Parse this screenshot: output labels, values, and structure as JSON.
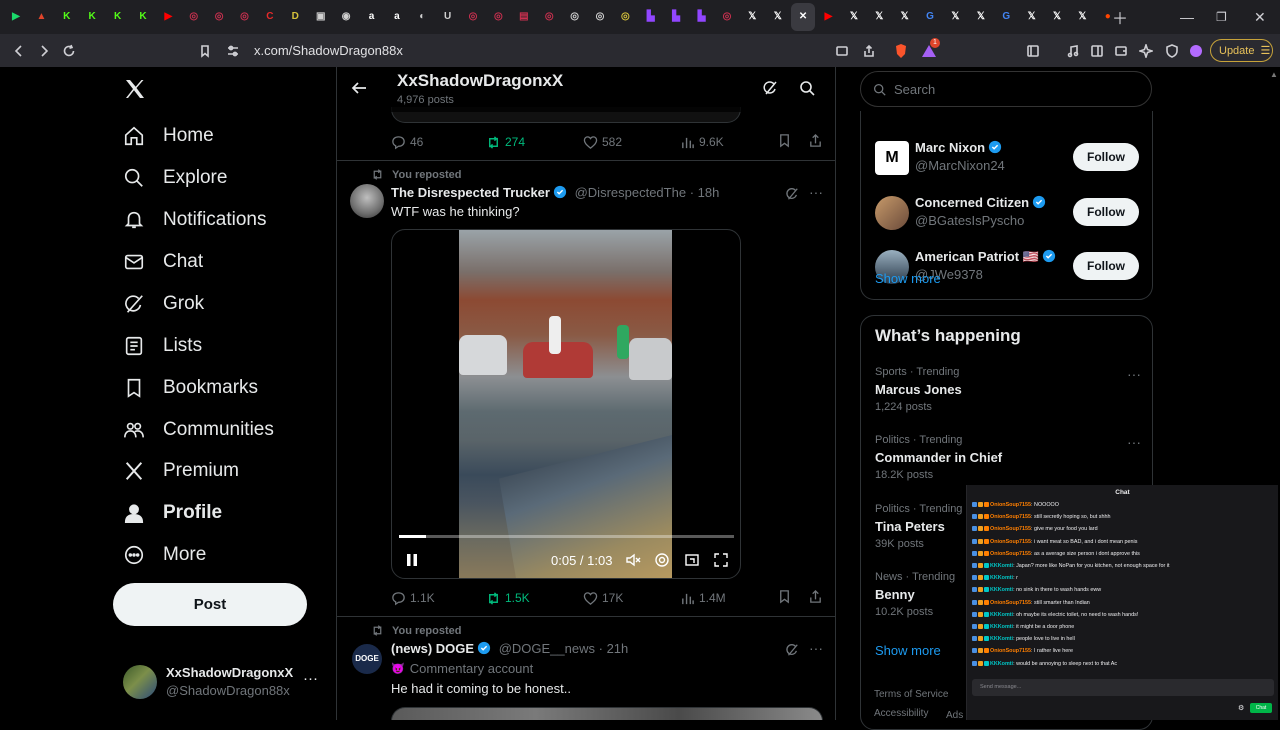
{
  "browser": {
    "tabs": [
      {
        "icon": "play-icon",
        "color": "#1bd96a",
        "glyph": "▶"
      },
      {
        "icon": "app-icon",
        "color": "#e0452b",
        "glyph": "▲"
      },
      {
        "icon": "kick-icon",
        "color": "#53fc18",
        "glyph": "K"
      },
      {
        "icon": "kick-icon",
        "color": "#53fc18",
        "glyph": "K"
      },
      {
        "icon": "kick-icon",
        "color": "#53fc18",
        "glyph": "K"
      },
      {
        "icon": "kick-icon",
        "color": "#53fc18",
        "glyph": "K"
      },
      {
        "icon": "youtube-icon",
        "color": "#ff0000",
        "glyph": "▶"
      },
      {
        "icon": "circle-icon",
        "color": "#c9304f",
        "glyph": "◎"
      },
      {
        "icon": "circle-icon",
        "color": "#c9304f",
        "glyph": "◎"
      },
      {
        "icon": "circle-icon",
        "color": "#c9304f",
        "glyph": "◎"
      },
      {
        "icon": "circle-icon",
        "color": "#e62a2a",
        "glyph": "C"
      },
      {
        "icon": "circle-icon",
        "color": "#d5c13a",
        "glyph": "D"
      },
      {
        "icon": "circle-icon",
        "color": "#d0d0d0",
        "glyph": "▣"
      },
      {
        "icon": "circle-icon",
        "color": "#d0d0d0",
        "glyph": "◉"
      },
      {
        "icon": "amazon-icon",
        "color": "#ffffff",
        "glyph": "a"
      },
      {
        "icon": "amazon-icon",
        "color": "#ffffff",
        "glyph": "a"
      },
      {
        "icon": "circle-icon",
        "color": "#d0d0d0",
        "glyph": "◐"
      },
      {
        "icon": "circle-icon",
        "color": "#d0d0d0",
        "glyph": "U"
      },
      {
        "icon": "circle-icon",
        "color": "#c9304f",
        "glyph": "◎"
      },
      {
        "icon": "circle-icon",
        "color": "#c9304f",
        "glyph": "◎"
      },
      {
        "icon": "circle-icon",
        "color": "#c9304f",
        "glyph": "▤"
      },
      {
        "icon": "circle-icon",
        "color": "#c9304f",
        "glyph": "◎"
      },
      {
        "icon": "circle-icon",
        "color": "#d0d0d0",
        "glyph": "◎"
      },
      {
        "icon": "circle-icon",
        "color": "#d0d0d0",
        "glyph": "◎"
      },
      {
        "icon": "circle-icon",
        "color": "#d5c13a",
        "glyph": "◎"
      },
      {
        "icon": "twitch-icon",
        "color": "#9146ff",
        "glyph": "▙"
      },
      {
        "icon": "twitch-icon",
        "color": "#9146ff",
        "glyph": "▙"
      },
      {
        "icon": "twitch-icon",
        "color": "#9146ff",
        "glyph": "▙"
      },
      {
        "icon": "circle-icon",
        "color": "#c9304f",
        "glyph": "◎"
      },
      {
        "icon": "x-icon",
        "color": "#ffffff",
        "glyph": "𝕏"
      },
      {
        "icon": "x-icon",
        "color": "#ffffff",
        "glyph": "𝕏"
      },
      {
        "icon": "close-icon",
        "color": "#ffffff",
        "glyph": "✕",
        "active": true
      },
      {
        "icon": "youtube-icon",
        "color": "#ff0000",
        "glyph": "▶"
      },
      {
        "icon": "x-icon",
        "color": "#ffffff",
        "glyph": "𝕏"
      },
      {
        "icon": "x-icon",
        "color": "#ffffff",
        "glyph": "𝕏"
      },
      {
        "icon": "x-icon",
        "color": "#ffffff",
        "glyph": "𝕏"
      },
      {
        "icon": "google-icon",
        "color": "#4285f4",
        "glyph": "G"
      },
      {
        "icon": "x-icon",
        "color": "#ffffff",
        "glyph": "𝕏"
      },
      {
        "icon": "x-icon",
        "color": "#ffffff",
        "glyph": "𝕏"
      },
      {
        "icon": "google-icon",
        "color": "#4285f4",
        "glyph": "G"
      },
      {
        "icon": "x-icon",
        "color": "#ffffff",
        "glyph": "𝕏"
      },
      {
        "icon": "x-icon",
        "color": "#ffffff",
        "glyph": "𝕏"
      },
      {
        "icon": "x-icon",
        "color": "#ffffff",
        "glyph": "𝕏"
      },
      {
        "icon": "reddit-icon",
        "color": "#ff4500",
        "glyph": "●"
      }
    ],
    "url": "x.com/ShadowDragon88x",
    "update_label": "Update",
    "notification_count": "1"
  },
  "sidebar": {
    "items": [
      {
        "label": "Home",
        "icon": "home-icon",
        "name": "home"
      },
      {
        "label": "Explore",
        "icon": "search-icon",
        "name": "explore"
      },
      {
        "label": "Notifications",
        "icon": "bell-icon",
        "name": "notifications"
      },
      {
        "label": "Chat",
        "icon": "mail-icon",
        "name": "chat"
      },
      {
        "label": "Grok",
        "icon": "grok-icon",
        "name": "grok"
      },
      {
        "label": "Lists",
        "icon": "list-icon",
        "name": "lists"
      },
      {
        "label": "Bookmarks",
        "icon": "bookmark-icon",
        "name": "bookmarks"
      },
      {
        "label": "Communities",
        "icon": "people-icon",
        "name": "communities"
      },
      {
        "label": "Premium",
        "icon": "x-logo-icon",
        "name": "premium"
      },
      {
        "label": "Profile",
        "icon": "person-icon",
        "name": "profile"
      },
      {
        "label": "More",
        "icon": "more-circle-icon",
        "name": "more"
      }
    ],
    "post_label": "Post",
    "account": {
      "name": "XxShadowDragonxX",
      "handle": "@ShadowDragon88x"
    }
  },
  "profile_header": {
    "name": "XxShadowDragonxX",
    "posts": "4,976 posts"
  },
  "timeline": {
    "top_stats": {
      "replies": "46",
      "reposts": "274",
      "likes": "582",
      "views": "9.6K"
    },
    "post1": {
      "reposted_label": "You reposted",
      "author": "The Disrespected Trucker",
      "handle": "@DisrespectedThe",
      "time": "· 18h",
      "text": "WTF was he thinking?",
      "video_time": "0:05 / 1:03",
      "video_progress": 0.08,
      "stats": {
        "replies": "1.1K",
        "reposts": "1.5K",
        "likes": "17K",
        "views": "1.4M"
      }
    },
    "post2": {
      "reposted_label": "You reposted",
      "author": "(news) DOGE",
      "handle": "@DOGE__news",
      "time": "· 21h",
      "tag": "Commentary account",
      "text": "He had it coming to be honest.."
    }
  },
  "right": {
    "search_placeholder": "Search",
    "follow_suggestions": [
      {
        "name": "Marc Nixon",
        "handle": "@MarcNixon24",
        "button": "Follow"
      },
      {
        "name": "Concerned Citizen",
        "handle": "@BGatesIsPyscho",
        "button": "Follow"
      },
      {
        "name": "American Patriot 🇺🇸",
        "handle": "@JWe9378",
        "button": "Follow"
      }
    ],
    "show_more": "Show more",
    "whats_happening_title": "What’s happening",
    "trends": [
      {
        "meta": "Sports · Trending",
        "name": "Marcus Jones",
        "count": "1,224 posts"
      },
      {
        "meta": "Politics · Trending",
        "name": "Commander in Chief",
        "count": "18.2K posts"
      },
      {
        "meta": "Politics · Trending",
        "name": "Tina Peters",
        "count": "39K posts"
      },
      {
        "meta": "News · Trending",
        "name": "Benny",
        "count": "10.2K posts"
      }
    ],
    "show_more_2": "Show more",
    "footer": [
      "Terms of Service",
      "Accessibility",
      "Ads I"
    ]
  },
  "chat": {
    "title": "Chat",
    "messages": [
      {
        "user": "OnionSoup7155",
        "color": "#ff7f00",
        "text": "NOOOOO"
      },
      {
        "user": "OnionSoup7155",
        "color": "#ff7f00",
        "text": "still secretly hoping so, but shhh"
      },
      {
        "user": "OnionSoup7155",
        "color": "#ff7f00",
        "text": "give me your food you lard"
      },
      {
        "user": "OnionSoup7155",
        "color": "#ff7f00",
        "text": "i want meat so BAD, and i dont mean penis"
      },
      {
        "user": "OnionSoup7155",
        "color": "#ff7f00",
        "text": "as a average size person i dont approve this"
      },
      {
        "user": "KKKomti",
        "color": "#00c8c8",
        "text": "Japan? more like NoPan for you kitchen, not enough space for it"
      },
      {
        "user": "KKKomti",
        "color": "#00c8c8",
        "text": "r"
      },
      {
        "user": "KKKomti",
        "color": "#00c8c8",
        "text": "no sink in there to wash hands eww"
      },
      {
        "user": "OnionSoup7155",
        "color": "#ff7f00",
        "text": "still smarter than Indian"
      },
      {
        "user": "KKKomti",
        "color": "#00c8c8",
        "text": "oh maybe its electric toilet, no need to wash hands!"
      },
      {
        "user": "KKKomti",
        "color": "#00c8c8",
        "text": "it might be a door phone"
      },
      {
        "user": "KKKomti",
        "color": "#00c8c8",
        "text": "people love to live in hell"
      },
      {
        "user": "OnionSoup7155",
        "color": "#ff7f00",
        "text": "I rather live here"
      },
      {
        "user": "KKKomti",
        "color": "#00c8c8",
        "text": "would be annoying to sleep next to that Ac"
      }
    ],
    "input_placeholder": "Send message...",
    "send_label": "Chat"
  },
  "colors": {
    "accent_green": "#00ba7c",
    "verified_blue": "#1d9bf0",
    "muted": "#71767b"
  }
}
